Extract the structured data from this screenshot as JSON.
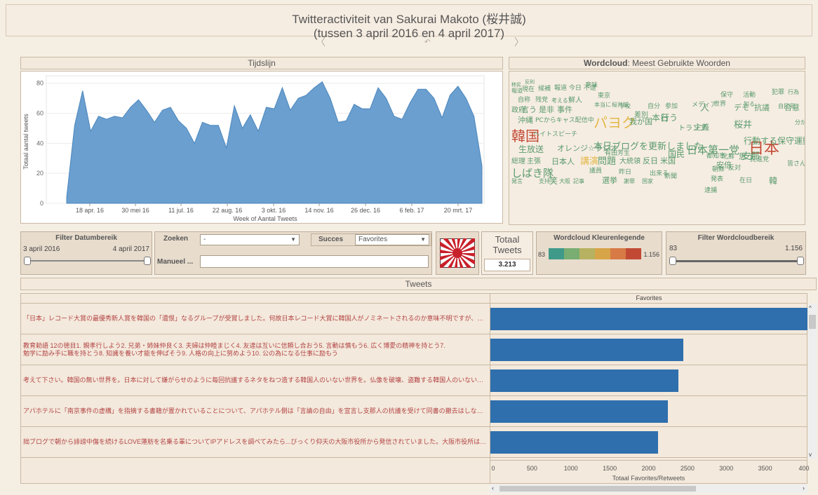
{
  "title": {
    "line1": "Twitteractiviteit van Sakurai Makoto (桜井誠)",
    "line2": "(tussen 3 april 2016 en 4 april 2017)"
  },
  "timeline": {
    "header": "Tijdslijn",
    "ylabel": "Totaal aantal tweets",
    "xlabel": "Week of Aantal Tweets",
    "ytick_labels": [
      "0",
      "20",
      "40",
      "60",
      "80"
    ],
    "xtick_labels": [
      "18 apr. 16",
      "30 mei 16",
      "11 jul. 16",
      "22 aug. 16",
      "3 okt. 16",
      "14 nov. 16",
      "26 dec. 16",
      "6 feb. 17",
      "20 mrt. 17"
    ]
  },
  "chart_data": [
    {
      "type": "area",
      "title": "Tijdslijn",
      "xlabel": "Week of Aantal Tweets",
      "ylabel": "Totaal aantal tweets",
      "ylim": [
        0,
        85
      ],
      "x": [
        "3 apr. 16",
        "10 apr. 16",
        "17 apr. 16",
        "24 apr. 16",
        "1 mei 16",
        "8 mei 16",
        "15 mei 16",
        "22 mei 16",
        "29 mei 16",
        "5 jun. 16",
        "12 jun. 16",
        "19 jun. 16",
        "26 jun. 16",
        "3 jul. 16",
        "10 jul. 16",
        "17 jul. 16",
        "24 jul. 16",
        "31 jul. 16",
        "7 aug. 16",
        "14 aug. 16",
        "21 aug. 16",
        "28 aug. 16",
        "4 sep. 16",
        "11 sep. 16",
        "18 sep. 16",
        "25 sep. 16",
        "2 okt. 16",
        "9 okt. 16",
        "16 okt. 16",
        "23 okt. 16",
        "30 okt. 16",
        "6 nov. 16",
        "13 nov. 16",
        "20 nov. 16",
        "27 nov. 16",
        "4 dec. 16",
        "11 dec. 16",
        "18 dec. 16",
        "25 dec. 16",
        "1 jan. 17",
        "8 jan. 17",
        "15 jan. 17",
        "22 jan. 17",
        "29 jan. 17",
        "5 feb. 17",
        "12 feb. 17",
        "19 feb. 17",
        "26 feb. 17",
        "5 mrt. 17",
        "12 mrt. 17",
        "19 mrt. 17",
        "26 mrt. 17",
        "2 apr. 17"
      ],
      "values": [
        4,
        52,
        75,
        48,
        58,
        56,
        58,
        57,
        64,
        69,
        62,
        54,
        62,
        64,
        55,
        50,
        40,
        54,
        52,
        52,
        37,
        65,
        50,
        59,
        48,
        64,
        63,
        77,
        62,
        70,
        72,
        77,
        81,
        70,
        54,
        55,
        66,
        63,
        63,
        77,
        70,
        58,
        56,
        67,
        76,
        76,
        70,
        57,
        72,
        78,
        70,
        58,
        25
      ]
    },
    {
      "type": "bar",
      "title": "Favorites",
      "xlabel": "Totaal Favorites/Retweets",
      "xlim": [
        0,
        4000
      ],
      "categories": [
        "「日本」レコード大賞",
        "教育勅語",
        "考えて下さい",
        "アパホテル",
        "拙ブログ"
      ],
      "values": [
        4100,
        2480,
        2420,
        2280,
        2160
      ]
    }
  ],
  "wordcloud": {
    "header_bold": "Wordcloud",
    "header_rest": ": Meest Gebruikte Woorden",
    "words": [
      {
        "t": "移民",
        "c": "#5a9a6e",
        "s": 7
      },
      {
        "t": "反則",
        "c": "#5a9a6e",
        "s": 7
      },
      {
        "t": "報道",
        "c": "#5a9a6e",
        "s": 8
      },
      {
        "t": "現在",
        "c": "#5a9a6e",
        "s": 9
      },
      {
        "t": "候補",
        "c": "#5a9a6e",
        "s": 9
      },
      {
        "t": "報道 今日 不逮",
        "c": "#5a9a6e",
        "s": 9
      },
      {
        "t": "意味",
        "c": "#5a9a6e",
        "s": 9
      },
      {
        "t": "自称",
        "c": "#5a9a6e",
        "s": 9
      },
      {
        "t": "残党",
        "c": "#5a9a6e",
        "s": 9
      },
      {
        "t": "考える",
        "c": "#5a9a6e",
        "s": 8
      },
      {
        "t": "鮮人",
        "c": "#5a9a6e",
        "s": 10
      },
      {
        "t": "東京",
        "c": "#5a9a6e",
        "s": 9
      },
      {
        "t": "政府",
        "c": "#5a9a6e",
        "s": 10
      },
      {
        "t": "言う",
        "c": "#5a9a6e",
        "s": 11
      },
      {
        "t": "是非",
        "c": "#5a9a6e",
        "s": 11
      },
      {
        "t": "事件",
        "c": "#5a9a6e",
        "s": 11
      },
      {
        "t": "本当に",
        "c": "#5a9a6e",
        "s": 8
      },
      {
        "t": "桜井誠",
        "c": "#5a9a6e",
        "s": 8
      },
      {
        "t": "沖縄",
        "c": "#5a9a6e",
        "s": 11
      },
      {
        "t": "PCからキャス配信中",
        "c": "#5a9a6e",
        "s": 9
      },
      {
        "t": "パヨク",
        "c": "#e3b84a",
        "s": 20
      },
      {
        "t": "我が国",
        "c": "#5a9a6e",
        "s": 11
      },
      {
        "t": "行う",
        "c": "#5a9a6e",
        "s": 12
      },
      {
        "t": "韓国",
        "c": "#c24a35",
        "s": 20
      },
      {
        "t": "ヘイトスピーチ",
        "c": "#5a9a6e",
        "s": 9
      },
      {
        "t": "本日ブログを更新しました",
        "c": "#5a9a6e",
        "s": 13
      },
      {
        "t": "日本第一党",
        "c": "#5a9a6e",
        "s": 15
      },
      {
        "t": "日本",
        "c": "#c24a35",
        "s": 22
      },
      {
        "t": "生放送",
        "c": "#5a9a6e",
        "s": 12
      },
      {
        "t": "オレンジ☆ラジオ",
        "c": "#5a9a6e",
        "s": 11
      },
      {
        "t": "有田芳生",
        "c": "#5a9a6e",
        "s": 9
      },
      {
        "t": "国民",
        "c": "#5a9a6e",
        "s": 12
      },
      {
        "t": "支那",
        "c": "#5a9a6e",
        "s": 13
      },
      {
        "t": "総理",
        "c": "#5a9a6e",
        "s": 10
      },
      {
        "t": "主張",
        "c": "#5a9a6e",
        "s": 10
      },
      {
        "t": "日本人",
        "c": "#5a9a6e",
        "s": 11
      },
      {
        "t": "講演",
        "c": "#e3b84a",
        "s": 13
      },
      {
        "t": "問題",
        "c": "#5a9a6e",
        "s": 13
      },
      {
        "t": "大統領",
        "c": "#5a9a6e",
        "s": 10
      },
      {
        "t": "反日",
        "c": "#5a9a6e",
        "s": 11
      },
      {
        "t": "米国",
        "c": "#5a9a6e",
        "s": 11
      },
      {
        "t": "しばき隊",
        "c": "#5a9a6e",
        "s": 15
      },
      {
        "t": "議員",
        "c": "#5a9a6e",
        "s": 9
      },
      {
        "t": "選挙",
        "c": "#5a9a6e",
        "s": 11
      },
      {
        "t": "昨日",
        "c": "#5a9a6e",
        "s": 9
      },
      {
        "t": "出来る",
        "c": "#5a9a6e",
        "s": 9
      },
      {
        "t": "新聞",
        "c": "#5a9a6e",
        "s": 9
      },
      {
        "t": "朝鮮",
        "c": "#5a9a6e",
        "s": 9
      },
      {
        "t": "反対",
        "c": "#5a9a6e",
        "s": 9
      },
      {
        "t": "韓",
        "c": "#5a9a6e",
        "s": 12
      },
      {
        "t": "発言",
        "c": "#5a9a6e",
        "s": 8
      },
      {
        "t": "支持",
        "c": "#5a9a6e",
        "s": 8
      },
      {
        "t": "笑",
        "c": "#5a9a6e",
        "s": 12
      },
      {
        "t": "大阪",
        "c": "#5a9a6e",
        "s": 8
      },
      {
        "t": "記事",
        "c": "#5a9a6e",
        "s": 8
      },
      {
        "t": "謝罪",
        "c": "#5a9a6e",
        "s": 8
      },
      {
        "t": "国家",
        "c": "#5a9a6e",
        "s": 8
      },
      {
        "t": "逮捕",
        "c": "#5a9a6e",
        "s": 9
      },
      {
        "t": "発表",
        "c": "#5a9a6e",
        "s": 9
      },
      {
        "t": "在日",
        "c": "#5a9a6e",
        "s": 9
      },
      {
        "t": "学校",
        "c": "#5a9a6e",
        "s": 8
      },
      {
        "t": "自分",
        "c": "#5a9a6e",
        "s": 9
      },
      {
        "t": "参加",
        "c": "#5a9a6e",
        "s": 9
      },
      {
        "t": "メディア",
        "c": "#5a9a6e",
        "s": 9
      },
      {
        "t": "人",
        "c": "#5a9a6e",
        "s": 13
      },
      {
        "t": "世界",
        "c": "#5a9a6e",
        "s": 9
      },
      {
        "t": "デモ",
        "c": "#5a9a6e",
        "s": 11
      },
      {
        "t": "抗議",
        "c": "#5a9a6e",
        "s": 11
      },
      {
        "t": "合意",
        "c": "#5a9a6e",
        "s": 11
      },
      {
        "t": "差別",
        "c": "#5a9a6e",
        "s": 10
      },
      {
        "t": "本日",
        "c": "#5a9a6e",
        "s": 12
      },
      {
        "t": "トランプ",
        "c": "#5a9a6e",
        "s": 10
      },
      {
        "t": "主義",
        "c": "#5a9a6e",
        "s": 11
      },
      {
        "t": "桜井",
        "c": "#5a9a6e",
        "s": 13
      },
      {
        "t": "行動する保守運動",
        "c": "#5a9a6e",
        "s": 12
      },
      {
        "t": "都知事",
        "c": "#5a9a6e",
        "s": 9
      },
      {
        "t": "北鮮",
        "c": "#5a9a6e",
        "s": 9
      },
      {
        "t": "思う",
        "c": "#5a9a6e",
        "s": 11
      },
      {
        "t": "民進党",
        "c": "#5a9a6e",
        "s": 9
      },
      {
        "t": "安倍",
        "c": "#5a9a6e",
        "s": 11
      },
      {
        "t": "皆さん",
        "c": "#5a9a6e",
        "s": 9
      },
      {
        "t": "保守",
        "c": "#5a9a6e",
        "s": 9
      },
      {
        "t": "活動",
        "c": "#5a9a6e",
        "s": 9
      },
      {
        "t": "犯罪",
        "c": "#5a9a6e",
        "s": 9
      },
      {
        "t": "行為",
        "c": "#5a9a6e",
        "s": 8
      },
      {
        "t": "知る",
        "c": "#5a9a6e",
        "s": 8
      },
      {
        "t": "自民党",
        "c": "#5a9a6e",
        "s": 8
      },
      {
        "t": "分かる",
        "c": "#5a9a6e",
        "s": 8
      },
      {
        "t": "声",
        "c": "#5a9a6e",
        "s": 10
      }
    ]
  },
  "filters": {
    "date": {
      "label": "Filter Datumbereik",
      "start": "3 april 2016",
      "end": "4 april 2017"
    },
    "search": {
      "label": "Zoeken",
      "value": "-"
    },
    "success": {
      "label": "Succes",
      "value": "Favorites"
    },
    "manual": {
      "label": "Manueel ...",
      "value": ""
    },
    "total": {
      "label_line1": "Totaal",
      "label_line2": "Tweets",
      "value": "3.213"
    },
    "legend": {
      "label": "Wordcloud Kleurenlegende",
      "min": "83",
      "max": "1.156",
      "colors": [
        "#3f9a8a",
        "#79ad72",
        "#b7b262",
        "#d8a448",
        "#d77a45",
        "#c24a35"
      ]
    },
    "wcrange": {
      "label": "Filter Wordcloudbereik",
      "min": "83",
      "max": "1.156"
    }
  },
  "tweets": {
    "header": "Tweets",
    "column_header": "Favorites",
    "axis_label": "Totaal Favorites/Retweets",
    "axis_ticks": [
      "0",
      "500",
      "1000",
      "1500",
      "2000",
      "2500",
      "3000",
      "3500",
      "400"
    ],
    "rows": [
      {
        "lines": [
          "「日本」レコード大賞の最優秀新人賞を韓国の「遺恨」なるグループが受賞しました。何故日本レコード大賞に韓国人がノミネートされるのか意味不明ですが、そもそもこの遺恨なるグルー..."
        ]
      },
      {
        "lines": [
          "教育勅語 12の徳目1. 親孝行しよう2. 兄弟・姉妹仲良く3. 夫婦は仲睦まじく4. 友達は互いに信頼し合おう5. 言動は慎もう6. 広く博愛の精神を持とう7.",
          "勉学に励み手に職を持とう8. 知識を養い才能を伸ばそう9. 人格の向上に努めよう10. 公の為になる仕事に励もう"
        ]
      },
      {
        "lines": [
          "考えて下さい。韓国の無い世界を。日本に対して嫌がらせのように毎回抗議するネタをねつ造する韓国人のいない世界を。仏像を破壊、盗難する韓国人のいない世界を。殺人、強姦、.."
        ]
      },
      {
        "lines": [
          "アパホテルに「南京事件の虚構」を指摘する書籍が置かれていることについて、アパホテル側は「言論の自由」を宣言し支那人の抗議を受けて同書の撤去はしない方針を明らかにしました..."
        ]
      },
      {
        "lines": [
          "拙ブログで朝から誹謗中傷を続けるLOVE蓮舫を名乗る輩についてIPアドレスを調べてみたら...びっくり仰天の大阪市役所から発信されていました。大阪市役所は確かヘイトスピーチ抑..."
        ]
      }
    ]
  }
}
